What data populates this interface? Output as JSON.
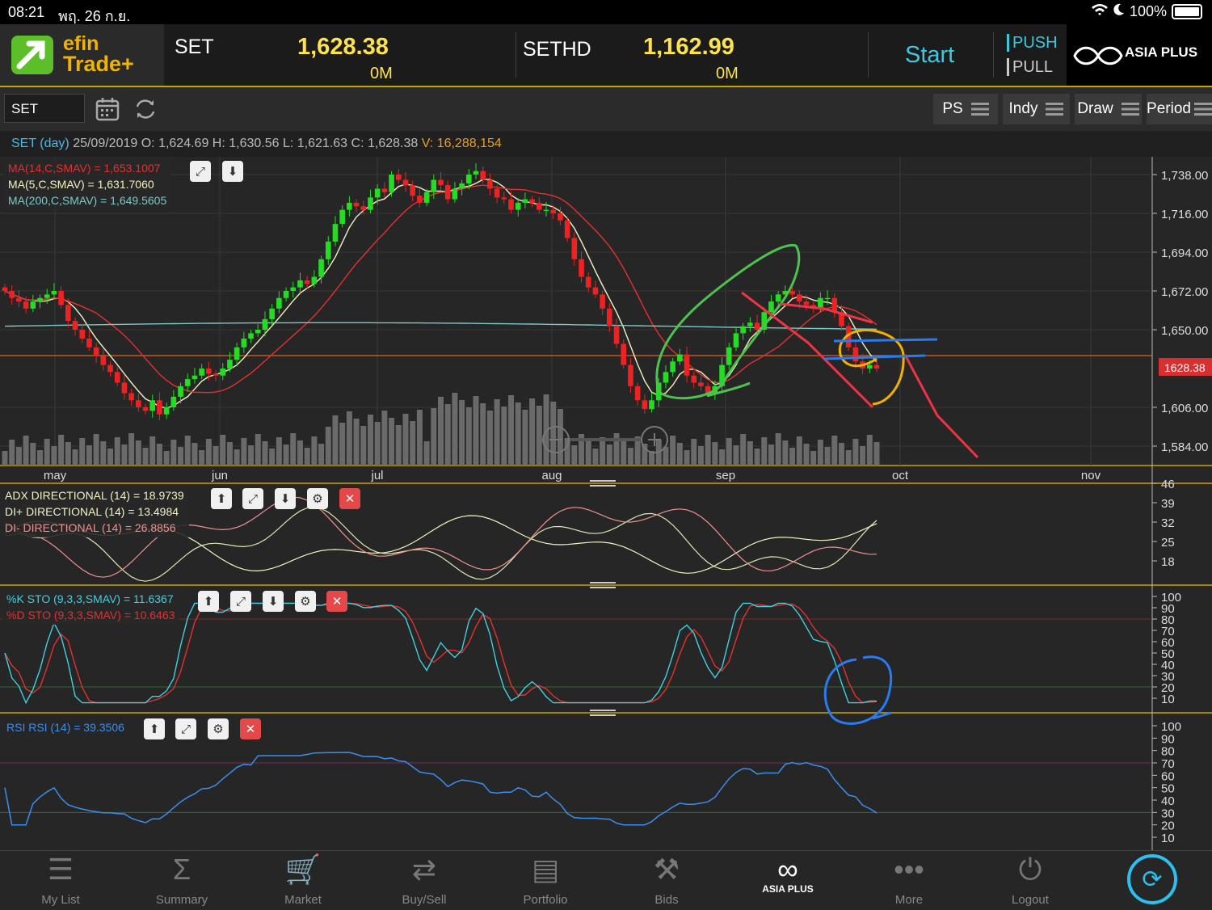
{
  "status": {
    "time": "08:21",
    "date": "พฤ. 26 ก.ย.",
    "battery": "100%"
  },
  "header": {
    "brand_line1": "efin",
    "brand_line2": "Trade+",
    "indices": [
      {
        "name": "SET",
        "value": "1,628.38",
        "volume": "0M"
      },
      {
        "name": "SETHD",
        "value": "1,162.99",
        "volume": "0M"
      }
    ],
    "start_label": "Start",
    "push_label": "PUSH",
    "pull_label": "PULL",
    "broker": "ASIA PLUS"
  },
  "toolbar": {
    "symbol": "SET",
    "ps": "PS",
    "indy": "Indy",
    "draw": "Draw",
    "period": "Period"
  },
  "info": {
    "symbol": "SET (day)",
    "date": "25/09/2019",
    "o_label": "O:",
    "o": "1,624.69",
    "h_label": "H:",
    "h": "1,630.56",
    "l_label": "L:",
    "l": "1,621.63",
    "c_label": "C:",
    "c": "1,628.38",
    "v_label": "V:",
    "v": "16,288,154"
  },
  "price_legend": [
    {
      "text": "MA(14,C,SMAV) = 1,653.1007",
      "color": "#e53030"
    },
    {
      "text": "MA(5,C,SMAV) = 1,631.7060",
      "color": "#f2f2c0"
    },
    {
      "text": "MA(200,C,SMAV) = 1,649.5605",
      "color": "#7ec8c8"
    }
  ],
  "adx_legend": [
    {
      "text": "ADX DIRECTIONAL (14) = 18.9739",
      "color": "#f2f2c0"
    },
    {
      "text": "DI+ DIRECTIONAL (14) = 13.4984",
      "color": "#f2f2c0"
    },
    {
      "text": "DI- DIRECTIONAL (14) = 26.8856",
      "color": "#f09090"
    }
  ],
  "sto_legend": [
    {
      "text": "%K STO (9,3,3,SMAV) = 11.6367",
      "color": "#40d0e0"
    },
    {
      "text": "%D STO (9,3,3,SMAV) = 10.6463",
      "color": "#e53030"
    }
  ],
  "rsi_legend": [
    {
      "text": "RSI RSI (14) = 39.3506",
      "color": "#3a8ef0"
    }
  ],
  "price_axis": [
    "1,738.00",
    "1,716.00",
    "1,694.00",
    "1,672.00",
    "1,650.00",
    "1,606.00",
    "1,584.00"
  ],
  "last_price_tag": "1628.38",
  "months": [
    "may",
    "jun",
    "jul",
    "aug",
    "sep",
    "oct",
    "nov"
  ],
  "adx_axis": [
    "46",
    "39",
    "32",
    "25",
    "18"
  ],
  "sto_axis": [
    "100",
    "90",
    "80",
    "70",
    "60",
    "50",
    "40",
    "30",
    "20",
    "10"
  ],
  "rsi_axis": [
    "100",
    "90",
    "80",
    "70",
    "60",
    "50",
    "40",
    "30",
    "20",
    "10"
  ],
  "chart_data": {
    "type": "candlestick",
    "symbol": "SET (day)",
    "x_months": [
      "may",
      "jun",
      "jul",
      "aug",
      "sep",
      "oct",
      "nov"
    ],
    "ylim": [
      1584,
      1738
    ],
    "close": [
      1672,
      1668,
      1666,
      1662,
      1666,
      1668,
      1670,
      1672,
      1664,
      1655,
      1650,
      1645,
      1640,
      1635,
      1630,
      1626,
      1620,
      1614,
      1610,
      1606,
      1604,
      1610,
      1602,
      1606,
      1612,
      1618,
      1622,
      1624,
      1628,
      1625,
      1624,
      1628,
      1633,
      1640,
      1645,
      1648,
      1650,
      1656,
      1662,
      1668,
      1672,
      1674,
      1678,
      1676,
      1680,
      1690,
      1700,
      1710,
      1718,
      1722,
      1720,
      1718,
      1725,
      1730,
      1728,
      1738,
      1735,
      1732,
      1726,
      1722,
      1728,
      1735,
      1732,
      1724,
      1730,
      1733,
      1738,
      1740,
      1735,
      1730,
      1725,
      1724,
      1718,
      1722,
      1724,
      1722,
      1718,
      1718,
      1716,
      1712,
      1702,
      1690,
      1680,
      1674,
      1670,
      1662,
      1652,
      1642,
      1630,
      1618,
      1610,
      1605,
      1610,
      1620,
      1626,
      1632,
      1636,
      1624,
      1620,
      1618,
      1614,
      1618,
      1630,
      1640,
      1648,
      1652,
      1654,
      1650,
      1660,
      1666,
      1670,
      1672,
      1670,
      1666,
      1664,
      1662,
      1668,
      1668,
      1660,
      1652,
      1640,
      1632,
      1628,
      1630,
      1628
    ],
    "ma_series": [
      "MA(14,C,SMAV)",
      "MA(5,C,SMAV)",
      "MA(200,C,SMAV)"
    ],
    "volume_present": true,
    "last": 1628.38
  }
}
